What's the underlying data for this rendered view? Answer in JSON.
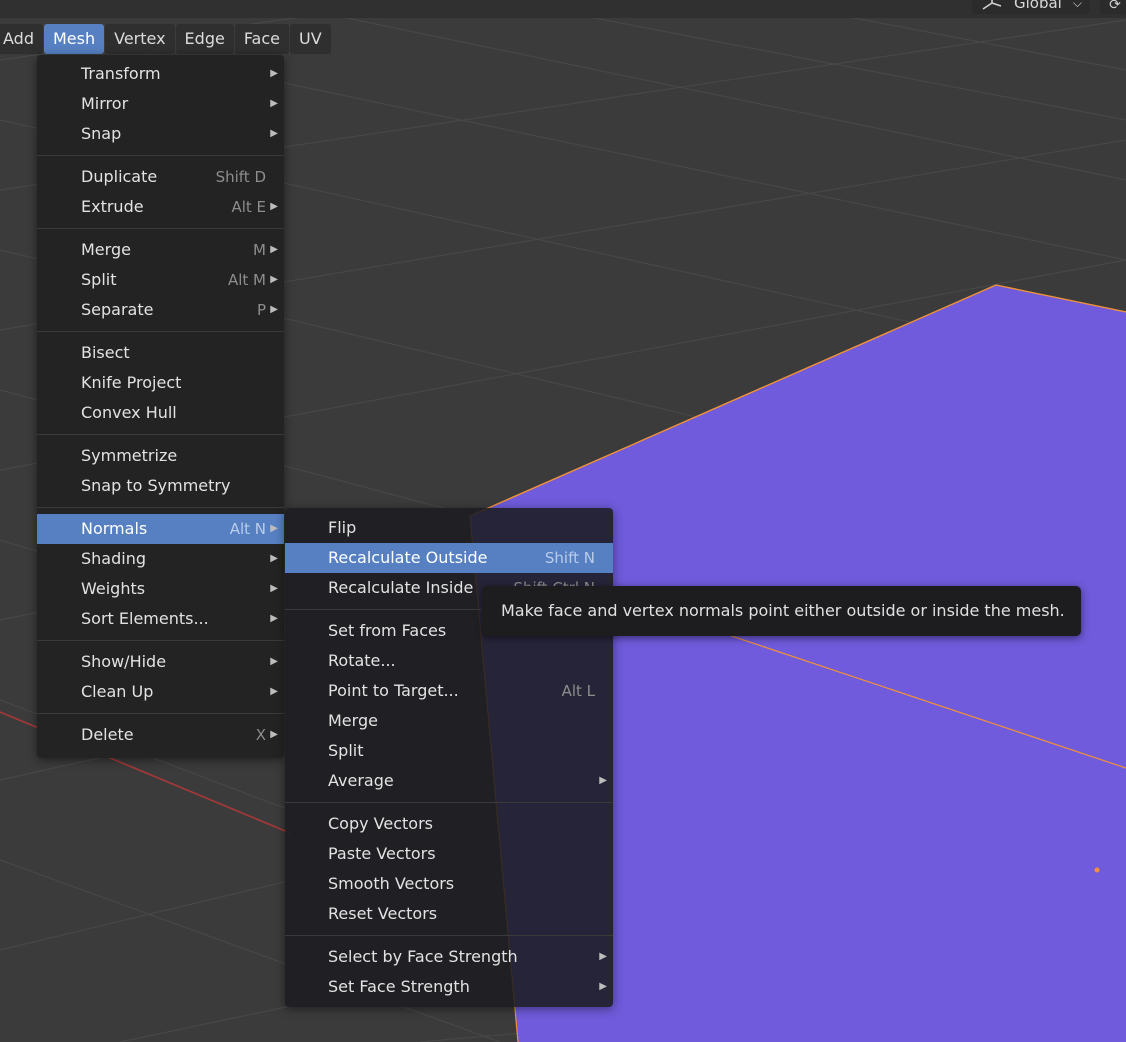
{
  "header": {
    "menubar": [
      {
        "label": "Add",
        "active": false
      },
      {
        "label": "Mesh",
        "active": true
      },
      {
        "label": "Vertex",
        "active": false
      },
      {
        "label": "Edge",
        "active": false
      },
      {
        "label": "Face",
        "active": false
      },
      {
        "label": "UV",
        "active": false
      }
    ],
    "orientation_dropdown": "Global",
    "right_icon": "refresh-icon"
  },
  "mesh_menu": {
    "groups": [
      [
        {
          "label": "Transform",
          "shortcut": "",
          "submenu": true
        },
        {
          "label": "Mirror",
          "shortcut": "",
          "submenu": true
        },
        {
          "label": "Snap",
          "shortcut": "",
          "submenu": true
        }
      ],
      [
        {
          "label": "Duplicate",
          "shortcut": "Shift D",
          "submenu": false
        },
        {
          "label": "Extrude",
          "shortcut": "Alt E",
          "submenu": true
        }
      ],
      [
        {
          "label": "Merge",
          "shortcut": "M",
          "submenu": true
        },
        {
          "label": "Split",
          "shortcut": "Alt M",
          "submenu": true
        },
        {
          "label": "Separate",
          "shortcut": "P",
          "submenu": true
        }
      ],
      [
        {
          "label": "Bisect",
          "shortcut": "",
          "submenu": false
        },
        {
          "label": "Knife Project",
          "shortcut": "",
          "submenu": false
        },
        {
          "label": "Convex Hull",
          "shortcut": "",
          "submenu": false
        }
      ],
      [
        {
          "label": "Symmetrize",
          "shortcut": "",
          "submenu": false
        },
        {
          "label": "Snap to Symmetry",
          "shortcut": "",
          "submenu": false
        }
      ],
      [
        {
          "label": "Normals",
          "shortcut": "Alt N",
          "submenu": true,
          "highlighted": true
        },
        {
          "label": "Shading",
          "shortcut": "",
          "submenu": true
        },
        {
          "label": "Weights",
          "shortcut": "",
          "submenu": true
        },
        {
          "label": "Sort Elements...",
          "shortcut": "",
          "submenu": true
        }
      ],
      [
        {
          "label": "Show/Hide",
          "shortcut": "",
          "submenu": true
        },
        {
          "label": "Clean Up",
          "shortcut": "",
          "submenu": true
        }
      ],
      [
        {
          "label": "Delete",
          "shortcut": "X",
          "submenu": true
        }
      ]
    ]
  },
  "normals_menu": {
    "groups": [
      [
        {
          "label": "Flip",
          "shortcut": "",
          "submenu": false
        },
        {
          "label": "Recalculate Outside",
          "shortcut": "Shift N",
          "submenu": false,
          "highlighted": true
        },
        {
          "label": "Recalculate Inside",
          "shortcut": "Shift Ctrl N",
          "submenu": false
        }
      ],
      [
        {
          "label": "Set from Faces",
          "shortcut": "",
          "submenu": false
        },
        {
          "label": "Rotate...",
          "shortcut": "",
          "submenu": false
        },
        {
          "label": "Point to Target...",
          "shortcut": "Alt L",
          "submenu": false
        },
        {
          "label": "Merge",
          "shortcut": "",
          "submenu": false
        },
        {
          "label": "Split",
          "shortcut": "",
          "submenu": false
        },
        {
          "label": "Average",
          "shortcut": "",
          "submenu": true
        }
      ],
      [
        {
          "label": "Copy Vectors",
          "shortcut": "",
          "submenu": false
        },
        {
          "label": "Paste Vectors",
          "shortcut": "",
          "submenu": false
        },
        {
          "label": "Smooth Vectors",
          "shortcut": "",
          "submenu": false
        },
        {
          "label": "Reset Vectors",
          "shortcut": "",
          "submenu": false
        }
      ],
      [
        {
          "label": "Select by Face Strength",
          "shortcut": "",
          "submenu": true
        },
        {
          "label": "Set Face Strength",
          "shortcut": "",
          "submenu": true
        }
      ]
    ]
  },
  "tooltip": {
    "text": "Make face and vertex normals point either outside or inside the mesh."
  },
  "colors": {
    "viewport_bg": "#3b3b3b",
    "grid_line": "#474747",
    "mesh_face": "#6f5bdb",
    "mesh_edge": "#f0913a",
    "x_axis": "#b33636",
    "highlight": "#5680c2",
    "menu_bg": "#232324"
  }
}
